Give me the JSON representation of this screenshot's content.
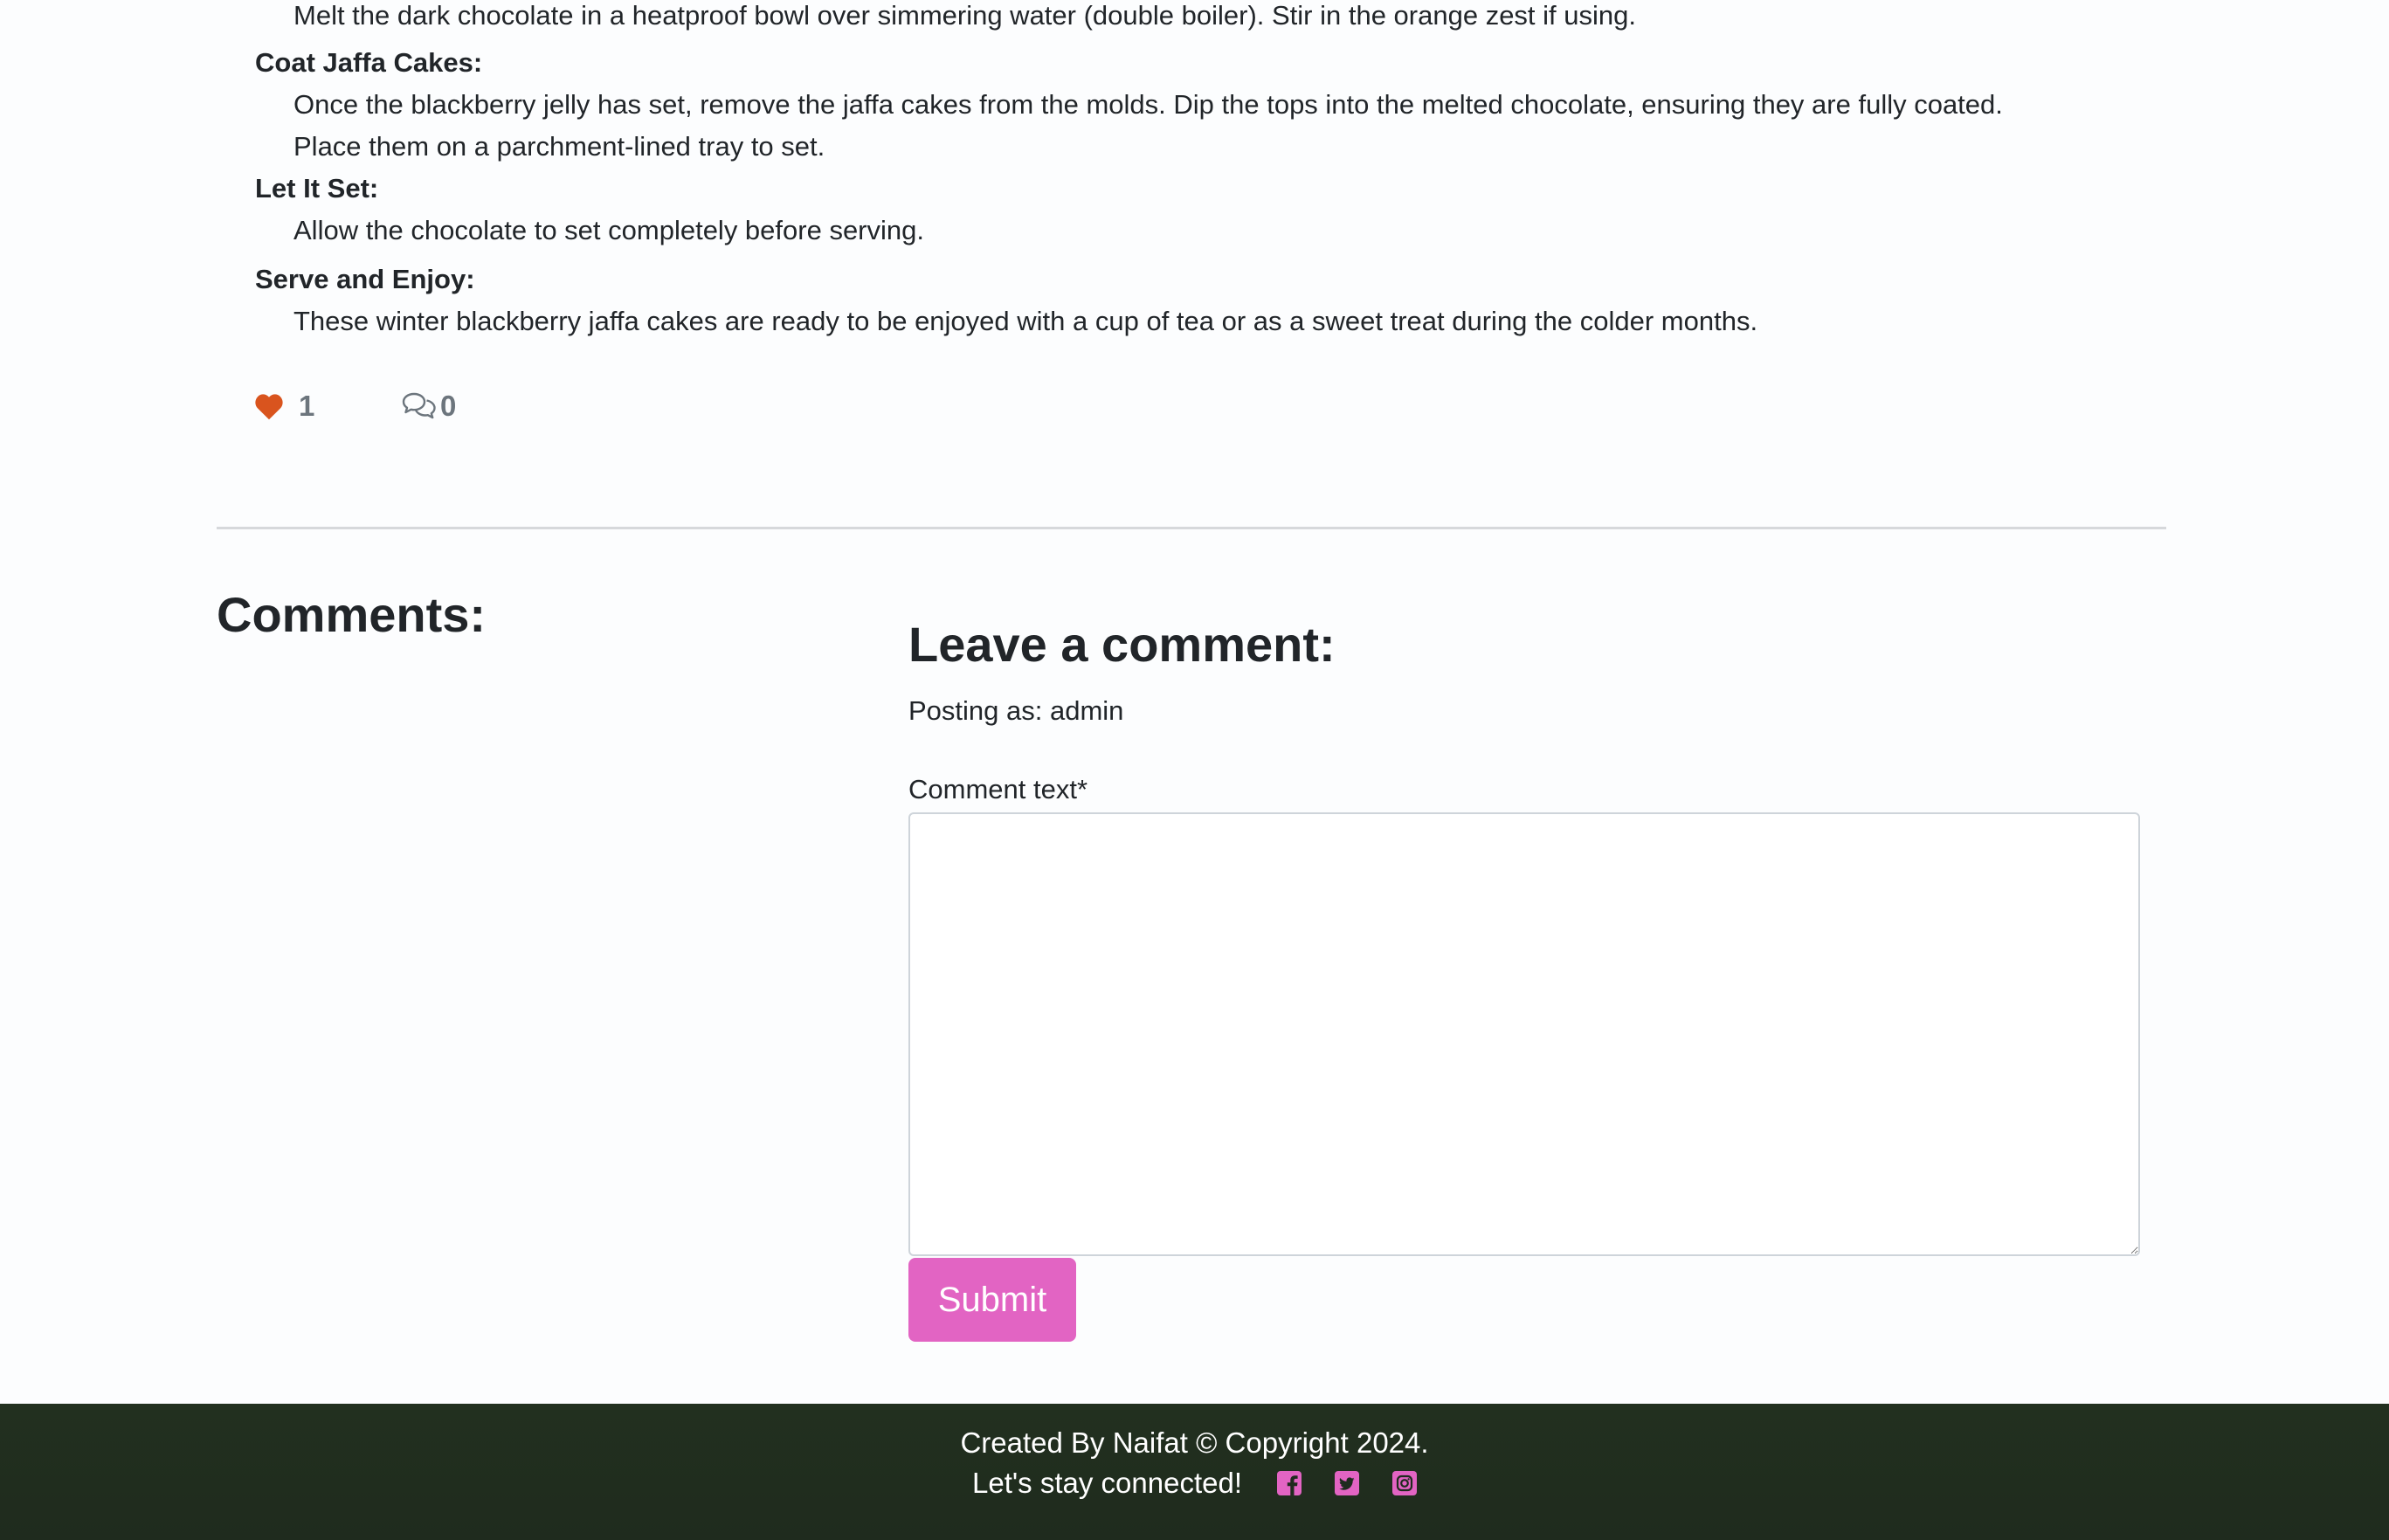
{
  "recipe": {
    "intro_step_text": "Melt the dark chocolate in a heatproof bowl over simmering water (double boiler). Stir in the orange zest if using.",
    "steps": [
      {
        "title": "Coat Jaffa Cakes:",
        "body_line1": "Once the blackberry jelly has set, remove the jaffa cakes from the molds. Dip the tops into the melted chocolate, ensuring they are fully coated.",
        "body_line2": "Place them on a parchment-lined tray to set."
      },
      {
        "title": "Let It Set:",
        "body_line1": "Allow the chocolate to set completely before serving."
      },
      {
        "title": "Serve and Enjoy:",
        "body_line1": "These winter blackberry jaffa cakes are ready to be enjoyed with a cup of tea or as a sweet treat during the colder months."
      }
    ]
  },
  "post_meta": {
    "likes_count": "1",
    "comments_count": "0",
    "like_icon": "heart-icon",
    "comment_icon": "comments-icon",
    "like_color": "#d9541e"
  },
  "comments_section": {
    "heading": "Comments:"
  },
  "comment_form": {
    "heading": "Leave a comment:",
    "posting_as": "Posting as: admin",
    "field_label": "Comment text*",
    "textarea_value": "",
    "submit_label": "Submit",
    "accent_color": "#e264c3"
  },
  "footer": {
    "copyright": "Created By Naifat © Copyright 2024.",
    "connect_text": "Let's stay connected!",
    "social_icons": [
      "facebook-icon",
      "twitter-icon",
      "instagram-icon"
    ],
    "background_color": "#22301f"
  }
}
